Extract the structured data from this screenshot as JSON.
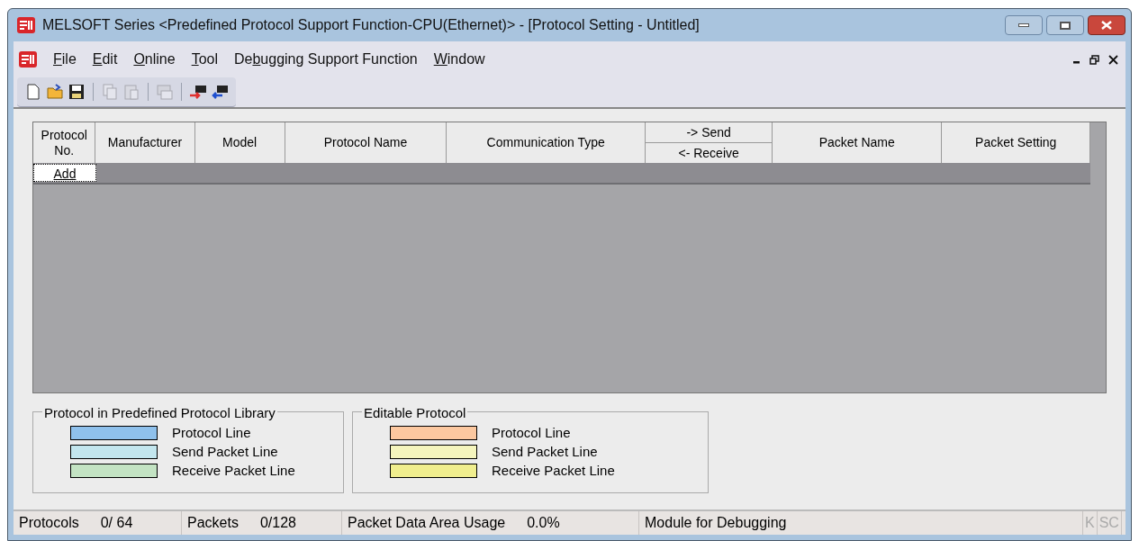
{
  "window": {
    "title": "MELSOFT Series <Predefined Protocol Support Function-CPU(Ethernet)> - [Protocol Setting - Untitled]"
  },
  "menu": [
    {
      "key": "F",
      "after": "ile"
    },
    {
      "key": "E",
      "after": "dit"
    },
    {
      "key": "O",
      "after": "nline"
    },
    {
      "key": "T",
      "after": "ool"
    },
    {
      "before": "De",
      "key": "b",
      "after": "ugging Support Function"
    },
    {
      "key": "W",
      "after": "indow"
    }
  ],
  "toolbar": [
    {
      "kind": "new",
      "disabled": false
    },
    {
      "kind": "open",
      "disabled": false
    },
    {
      "kind": "save",
      "disabled": false
    },
    {
      "kind": "sep"
    },
    {
      "kind": "copy",
      "disabled": true
    },
    {
      "kind": "paste",
      "disabled": true
    },
    {
      "kind": "sep"
    },
    {
      "kind": "print",
      "disabled": true
    },
    {
      "kind": "sep"
    },
    {
      "kind": "write",
      "disabled": false
    },
    {
      "kind": "read",
      "disabled": false
    }
  ],
  "table": {
    "columns": [
      {
        "kind": "plain",
        "label": "Protocol No."
      },
      {
        "kind": "plain",
        "label": "Manufacturer"
      },
      {
        "kind": "plain",
        "label": "Model"
      },
      {
        "kind": "plain",
        "label": "Protocol Name"
      },
      {
        "kind": "plain",
        "label": "Communication Type"
      },
      {
        "kind": "split",
        "top": "-> Send",
        "bottom": "<- Receive"
      },
      {
        "kind": "plain",
        "label": "Packet Name"
      },
      {
        "kind": "plain",
        "label": "Packet Setting"
      }
    ],
    "add_button": "Add"
  },
  "legends": [
    {
      "title": "Protocol in Predefined Protocol Library",
      "items": [
        {
          "label": "Protocol Line",
          "color": "#8fc1ec"
        },
        {
          "label": "Send Packet Line",
          "color": "#c3e6ee"
        },
        {
          "label": "Receive Packet Line",
          "color": "#c3e3c3"
        }
      ]
    },
    {
      "title": "Editable Protocol",
      "items": [
        {
          "label": "Protocol Line",
          "color": "#fcc8a0"
        },
        {
          "label": "Send Packet Line",
          "color": "#f5f5bd"
        },
        {
          "label": "Receive Packet Line",
          "color": "#f0ee8e"
        }
      ]
    }
  ],
  "status_bar": [
    {
      "label": "Protocols",
      "value": "0/ 64"
    },
    {
      "label": "Packets",
      "value": "0/128"
    },
    {
      "label": "Packet Data Area Usage",
      "value": "0.0%"
    },
    {
      "label": "Module for Debugging"
    }
  ],
  "indicators": [
    {
      "text": "K",
      "disabled": true
    },
    {
      "text": "SC",
      "disabled": true
    }
  ]
}
